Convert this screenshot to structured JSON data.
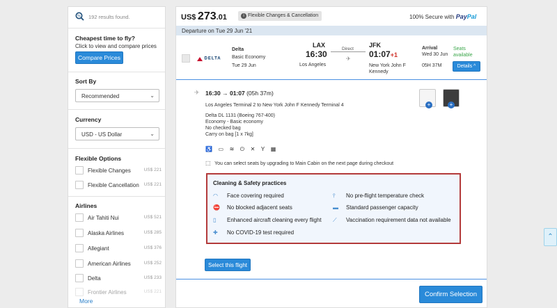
{
  "sidebar": {
    "results_count": "192 results found.",
    "cheapest": {
      "title": "Cheapest time to fly?",
      "subtitle": "Click to view and compare prices",
      "button": "Compare Prices"
    },
    "sort": {
      "title": "Sort By",
      "value": "Recommended"
    },
    "currency": {
      "title": "Currency",
      "value": "USD - US Dollar"
    },
    "flexible": {
      "title": "Flexible Options",
      "items": [
        {
          "label": "Flexible Changes",
          "price": "US$ 221"
        },
        {
          "label": "Flexible Cancellation",
          "price": "US$ 221"
        }
      ]
    },
    "airlines": {
      "title": "Airlines",
      "items": [
        {
          "label": "Air Tahiti Nui",
          "price": "US$ 521"
        },
        {
          "label": "Alaska Airlines",
          "price": "US$ 285"
        },
        {
          "label": "Allegiant",
          "price": "US$ 376"
        },
        {
          "label": "American Airlines",
          "price": "US$ 252"
        },
        {
          "label": "Delta",
          "price": "US$ 233"
        },
        {
          "label": "Frontier Airlines",
          "price": "US$ 221"
        }
      ],
      "more": "More"
    }
  },
  "main": {
    "price_currency": "US$",
    "price_main": "273",
    "price_cents": ".01",
    "badge": "Flexible Changes & Cancellation",
    "secure_text": "100% Secure with",
    "paypal_pay": "Pay",
    "paypal_pal": "Pal",
    "departure": "Departure on Tue 29 Jun '21",
    "flight": {
      "airline_logo": "DELTA",
      "airline": "Delta",
      "fare": "Basic Economy",
      "date": "Tue 29 Jun",
      "from_code": "LAX",
      "from_time": "16:30",
      "from_city": "Los Angeles",
      "stops": "Direct",
      "to_code": "JFK",
      "to_time": "01:07",
      "day_offset": "+1",
      "to_city": "New York John F Kennedy",
      "arrival_label": "Arrival",
      "arrival_date": "Wed 30 Jun",
      "duration": "05H 37M",
      "seats": "Seats available",
      "details_button": "Details"
    },
    "segment": {
      "times": "16:30 → 01:07",
      "duration": "(05h 37m)",
      "route": "Los Angeles Terminal 2 to New York John F Kennedy Terminal 4",
      "flight_no": "Delta DL 1131 (Boeing 767-400)",
      "cabin": "Economy - Basic economy",
      "bag1": "No checked bag",
      "bag2": "Carry on bag [1 x 7kg]",
      "seat_note": "You can select seats by upgrading to Main Cabin on the next page during checkout"
    },
    "cleaning": {
      "title": "Cleaning & Safety practices",
      "left": [
        "Face covering required",
        "No blocked adjacent seats",
        "Enhanced aircraft cleaning every flight",
        "No COVID-19 test required"
      ],
      "right": [
        "No pre-flight temperature check",
        "Standard passenger capacity",
        "Vaccination requirement data not available"
      ]
    },
    "select_button": "Select this flight",
    "confirm_button": "Confirm Selection"
  },
  "colors": {
    "accent": "#2a8ad9",
    "red_price": "#d0342c",
    "green": "#3aa64a",
    "highlight_border": "#b33a3a"
  }
}
